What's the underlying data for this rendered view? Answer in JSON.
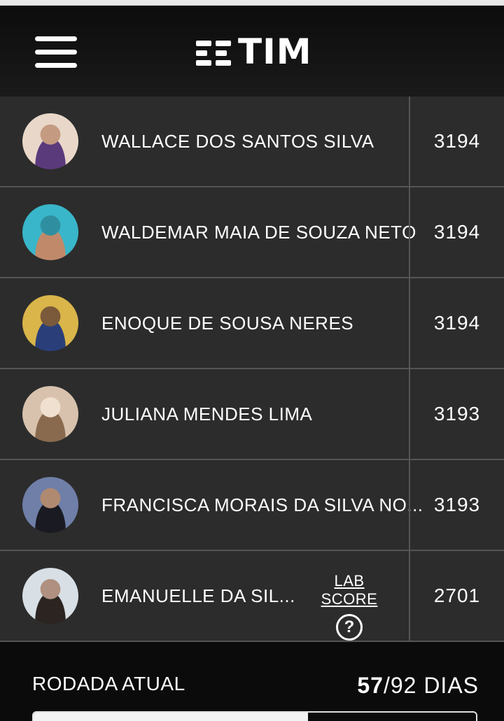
{
  "header": {
    "logo_text": "TIM"
  },
  "ranking": [
    {
      "name": "WALLACE DOS SANTOS SILVA",
      "score": "3194",
      "avatar_colors": [
        "#e9d8c9",
        "#5b3a7c",
        "#c49a80"
      ]
    },
    {
      "name": "WALDEMAR MAIA DE SOUZA NETO",
      "score": "3194",
      "avatar_colors": [
        "#39b6c9",
        "#c08a6a",
        "#2f8fa0"
      ]
    },
    {
      "name": "ENOQUE DE SOUSA NERES",
      "score": "3194",
      "avatar_colors": [
        "#d9b54a",
        "#2a3f7a",
        "#7a5a3a"
      ]
    },
    {
      "name": "JULIANA MENDES LIMA",
      "score": "3193",
      "avatar_colors": [
        "#d8c2ad",
        "#8a6a4e",
        "#f0e0d0"
      ]
    },
    {
      "name": "FRANCISCA MORAIS DA SILVA NO...",
      "score": "3193",
      "avatar_colors": [
        "#6f7fa8",
        "#1a1a22",
        "#b08a70"
      ]
    },
    {
      "name": "EMANUELLE DA SIL...",
      "score": "2701",
      "avatar_colors": [
        "#d8e0e6",
        "#2b2420",
        "#b09080"
      ],
      "lab_score": "LAB SCORE"
    }
  ],
  "footer": {
    "round_label": "RODADA ATUAL",
    "days_current": "57",
    "days_rest": "/92 DIAS",
    "progress": 0.62
  }
}
